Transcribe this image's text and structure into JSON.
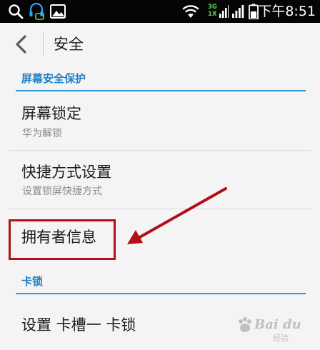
{
  "status_bar": {
    "time": "下午8:51",
    "network_3g": "3G",
    "network_1x": "1X"
  },
  "header": {
    "title": "安全"
  },
  "sections": [
    {
      "label": "屏幕安全保护"
    },
    {
      "label": "卡锁"
    }
  ],
  "items": [
    {
      "title": "屏幕锁定",
      "subtitle": "华为解锁"
    },
    {
      "title": "快捷方式设置",
      "subtitle": "设置锁屏快捷方式"
    },
    {
      "title": "拥有者信息"
    },
    {
      "title": "设置 卡槽一 卡锁"
    }
  ],
  "watermark": {
    "brand": "Bai du",
    "sub": "经验"
  },
  "colors": {
    "accent": "#2e96d9",
    "section_text": "#2381c6",
    "annotation_red": "#b30f18",
    "background": "#f4f4f4",
    "status_bar": "#050505"
  }
}
